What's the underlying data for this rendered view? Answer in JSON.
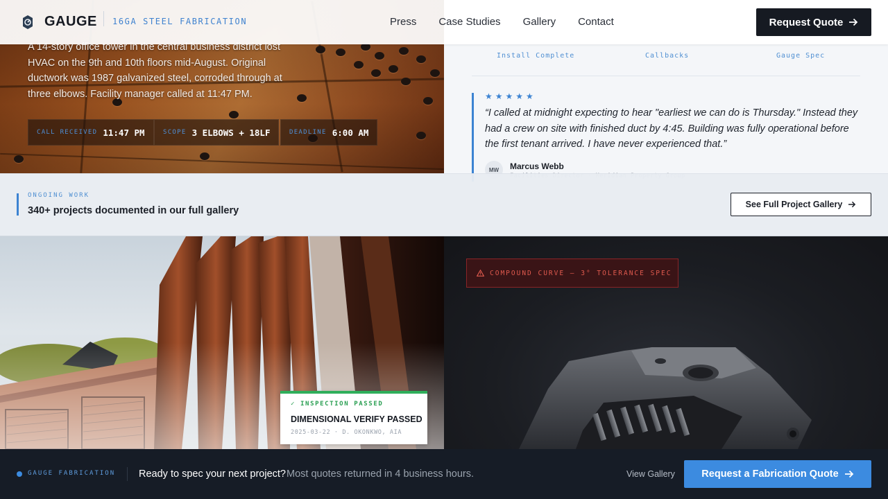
{
  "header": {
    "brand": "GAUGE",
    "tagline": "16GA STEEL FABRICATION",
    "nav": [
      "Press",
      "Case Studies",
      "Gallery",
      "Contact"
    ],
    "cta_label": "Request Quote"
  },
  "case_study": {
    "body": "A 14-story office tower in the central business district lost HVAC on the 9th and 10th floors mid-August. Original ductwork was 1987 galvanized steel, corroded through at three elbows. Facility manager called at 11:47 PM.",
    "stats": [
      {
        "label": "CALL RECEIVED",
        "value": "11:47 PM"
      },
      {
        "label": "SCOPE",
        "value": "3 ELBOWS + 18LF"
      },
      {
        "label": "DEADLINE",
        "value": "6:00 AM"
      }
    ]
  },
  "testimonial": {
    "metrics": [
      "Install Complete",
      "Callbacks",
      "Gauge Spec"
    ],
    "stars": "★★★★★",
    "quote": "“I called at midnight expecting to hear \"earliest we can do is Thursday.\" Instead they had a crew on site with finished duct by 4:45. Building was fully operational before the first tenant arrived. I have never experienced that.”",
    "initials": "MW",
    "author": "Marcus Webb",
    "role": "Facilities Director · Meridian Property Group"
  },
  "gallery_strip": {
    "label": "ONGOING WORK",
    "title": "340+ projects documented in our full gallery",
    "button": "See Full Project Gallery"
  },
  "inspection": {
    "label": "✓ INSPECTION PASSED",
    "title": "DIMENSIONAL VERIFY PASSED",
    "meta": "2025-03-22 · D. OKONKWO, AIA"
  },
  "warning": {
    "text": "COMPOUND CURVE — 3° TOLERANCE SPEC"
  },
  "footer": {
    "brand": "GAUGE FABRICATION",
    "title": "Ready to spec your next project?",
    "subtitle": "Most quotes returned in 4 business hours.",
    "link": "View Gallery",
    "cta": "Request a Fabrication Quote"
  },
  "colors": {
    "accent_blue": "#3c8be0",
    "dark": "#161a22",
    "success": "#2fae5b",
    "warning": "#e05a4e"
  }
}
